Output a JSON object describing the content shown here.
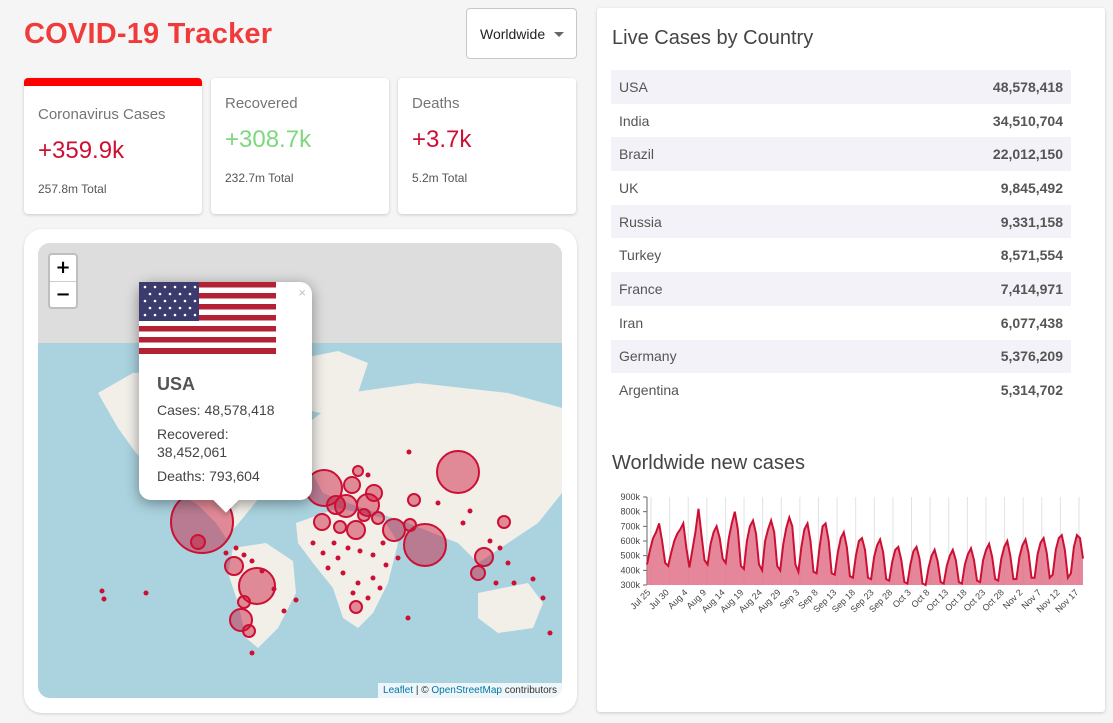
{
  "header": {
    "title": "COVID-19 Tracker",
    "region": "Worldwide"
  },
  "stats": [
    {
      "label": "Coronavirus Cases",
      "value": "+359.9k",
      "total": "257.8m Total"
    },
    {
      "label": "Recovered",
      "value": "+308.7k",
      "total": "232.7m Total"
    },
    {
      "label": "Deaths",
      "value": "+3.7k",
      "total": "5.2m Total"
    }
  ],
  "map": {
    "zoom_in": "+",
    "zoom_out": "−",
    "popup": {
      "close": "×",
      "country": "USA",
      "cases": "Cases: 48,578,418",
      "recovered": "Recovered: 38,452,061",
      "deaths": "Deaths: 793,604"
    },
    "attribution": {
      "leaflet": "Leaflet",
      "sep": " | © ",
      "osm": "OpenStreetMap",
      "suffix": " contributors"
    }
  },
  "table": {
    "title": "Live Cases by Country",
    "rows": [
      {
        "country": "USA",
        "cases": "48,578,418"
      },
      {
        "country": "India",
        "cases": "34,510,704"
      },
      {
        "country": "Brazil",
        "cases": "22,012,150"
      },
      {
        "country": "UK",
        "cases": "9,845,492"
      },
      {
        "country": "Russia",
        "cases": "9,331,158"
      },
      {
        "country": "Turkey",
        "cases": "8,571,554"
      },
      {
        "country": "France",
        "cases": "7,414,971"
      },
      {
        "country": "Iran",
        "cases": "6,077,438"
      },
      {
        "country": "Germany",
        "cases": "5,376,209"
      },
      {
        "country": "Argentina",
        "cases": "5,314,702"
      }
    ]
  },
  "colors": {
    "accent": "#cc1034",
    "title": "#f03b3b",
    "recovered": "#7dd87d",
    "selected_bar": "#ff0000",
    "area_fill": "#e07188"
  },
  "chart_data": {
    "type": "area",
    "title": "Worldwide new cases",
    "ylim": [
      300000,
      900000
    ],
    "yticks": [
      "300k",
      "400k",
      "500k",
      "600k",
      "700k",
      "800k",
      "900k"
    ],
    "x_ticks": [
      "Jul 25",
      "Jul 30",
      "Aug 4",
      "Aug 9",
      "Aug 14",
      "Aug 19",
      "Aug 24",
      "Aug 29",
      "Sep 3",
      "Sep 8",
      "Sep 13",
      "Sep 18",
      "Sep 23",
      "Sep 28",
      "Oct 3",
      "Oct 8",
      "Oct 13",
      "Oct 18",
      "Oct 23",
      "Oct 28",
      "Nov 2",
      "Nov 7",
      "Nov 12",
      "Nov 17"
    ],
    "values": [
      440000,
      540000,
      620000,
      660000,
      720000,
      600000,
      450000,
      430000,
      520000,
      600000,
      650000,
      680000,
      720000,
      550000,
      420000,
      540000,
      660000,
      820000,
      640000,
      470000,
      440000,
      580000,
      660000,
      700000,
      620000,
      480000,
      450000,
      620000,
      720000,
      800000,
      680000,
      430000,
      410000,
      600000,
      700000,
      740000,
      650000,
      440000,
      400000,
      600000,
      680000,
      740000,
      660000,
      430000,
      400000,
      580000,
      690000,
      760000,
      700000,
      440000,
      390000,
      560000,
      680000,
      720000,
      600000,
      390000,
      380000,
      560000,
      700000,
      720000,
      600000,
      380000,
      370000,
      520000,
      620000,
      660000,
      560000,
      360000,
      350000,
      500000,
      600000,
      620000,
      540000,
      350000,
      340000,
      490000,
      570000,
      610000,
      520000,
      340000,
      330000,
      460000,
      540000,
      560000,
      470000,
      320000,
      310000,
      440000,
      530000,
      560000,
      480000,
      310000,
      300000,
      420000,
      500000,
      540000,
      460000,
      320000,
      310000,
      430000,
      500000,
      540000,
      470000,
      320000,
      310000,
      440000,
      510000,
      550000,
      470000,
      330000,
      320000,
      470000,
      540000,
      580000,
      490000,
      340000,
      330000,
      480000,
      560000,
      600000,
      500000,
      340000,
      340000,
      490000,
      570000,
      610000,
      520000,
      350000,
      350000,
      510000,
      590000,
      620000,
      520000,
      350000,
      370000,
      540000,
      620000,
      640000,
      540000,
      350000,
      380000,
      560000,
      640000,
      620000,
      480000
    ]
  }
}
